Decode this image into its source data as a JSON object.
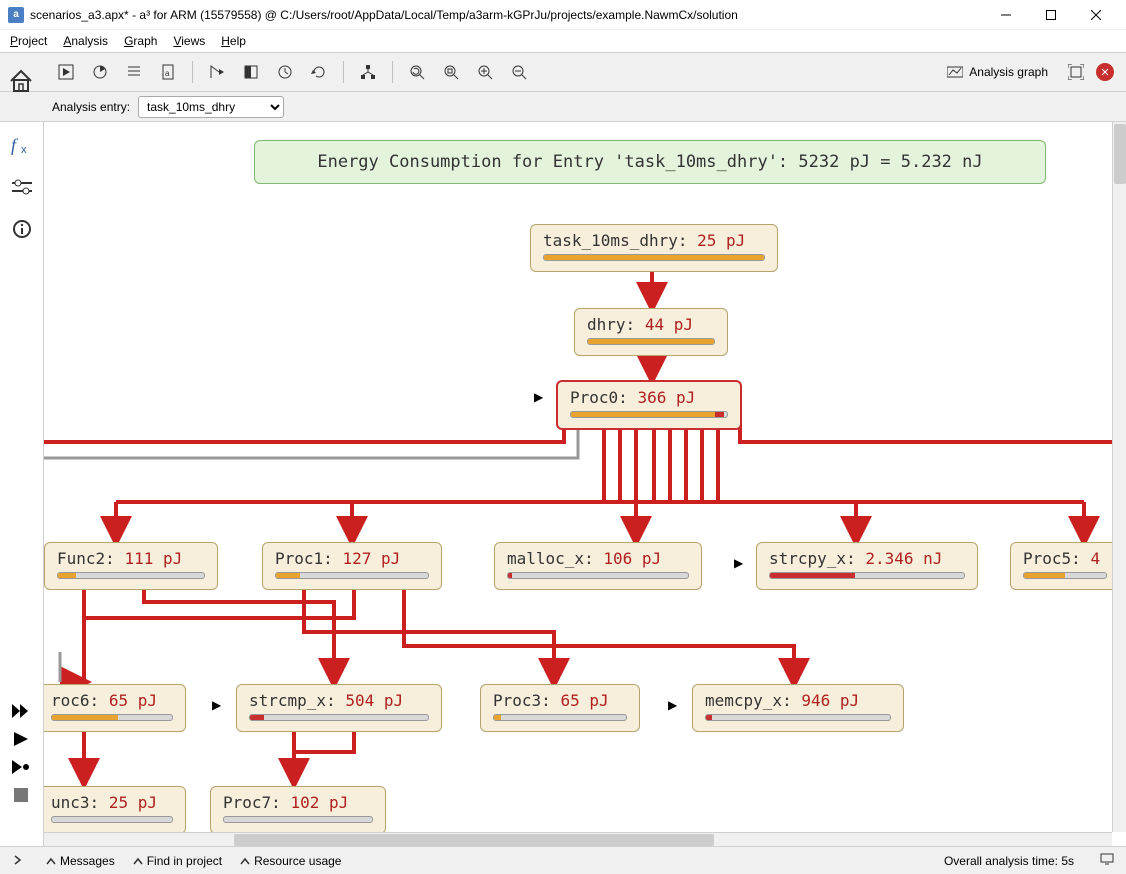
{
  "window": {
    "title": "scenarios_a3.apx* - a³ for ARM (15579558) @ C:/Users/root/AppData/Local/Temp/a3arm-kGPrJu/projects/example.NawmCx/solution",
    "app_icon_letter": "a"
  },
  "menubar": {
    "project": "Project",
    "analysis": "Analysis",
    "graph": "Graph",
    "views": "Views",
    "help": "Help"
  },
  "toolbar": {
    "analysis_graph": "Analysis graph"
  },
  "entry_row": {
    "label": "Analysis entry:",
    "selected": "task_10ms_dhry",
    "options": [
      "task_10ms_dhry"
    ]
  },
  "banner": {
    "text": "Energy Consumption for Entry 'task_10ms_dhry': 5232 pJ = 5.232 nJ"
  },
  "nodes": {
    "n0": {
      "label": "task_10ms_dhry:",
      "value": "25 pJ",
      "barPct": 100,
      "barColor": "orange"
    },
    "n1": {
      "label": "dhry:",
      "value": "44 pJ",
      "barPct": 100,
      "barColor": "orange"
    },
    "n2": {
      "label": "Proc0:",
      "value": "366 pJ",
      "barPct": 92,
      "barColor": "orange"
    },
    "n3": {
      "label": "Func2:",
      "value": "111 pJ",
      "barPct": 12,
      "barColor": "orange"
    },
    "n4": {
      "label": "Proc1:",
      "value": "127 pJ",
      "barPct": 16,
      "barColor": "orange"
    },
    "n5": {
      "label": "malloc_x:",
      "value": "106 pJ",
      "barPct": 2,
      "barColor": "red"
    },
    "n6": {
      "label": "strcpy_x:",
      "value": "2.346 nJ",
      "barPct": 44,
      "barColor": "red"
    },
    "n7": {
      "label": "Proc5:",
      "value": "4",
      "barPct": 50,
      "barColor": "orange"
    },
    "n8": {
      "label": "roc6:",
      "value": "65 pJ",
      "barPct": 55,
      "barColor": "orange"
    },
    "n9": {
      "label": "strcmp_x:",
      "value": "504 pJ",
      "barPct": 8,
      "barColor": "red"
    },
    "n10": {
      "label": "Proc3:",
      "value": "65 pJ",
      "barPct": 5,
      "barColor": "orange"
    },
    "n11": {
      "label": "memcpy_x:",
      "value": "946 pJ",
      "barPct": 3,
      "barColor": "red"
    },
    "n12": {
      "label": "unc3:",
      "value": "25 pJ",
      "barPct": 0,
      "barColor": "orange"
    },
    "n13": {
      "label": "Proc7:",
      "value": "102 pJ",
      "barPct": 0,
      "barColor": "orange"
    }
  },
  "statusbar": {
    "messages": "Messages",
    "find": "Find in project",
    "resource": "Resource usage",
    "analysis_time": "Overall analysis time: 5s"
  }
}
